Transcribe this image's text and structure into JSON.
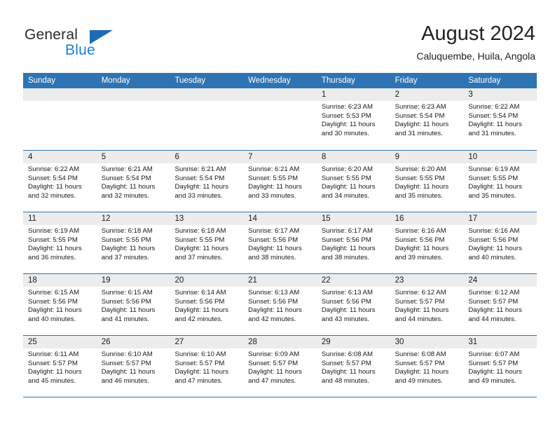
{
  "brand": {
    "name_dark": "General",
    "name_blue": "Blue",
    "accent_blue": "#1f7fd4",
    "triangle_blue": "#1c6cb5"
  },
  "header": {
    "title": "August 2024",
    "subtitle": "Caluquembe, Huila, Angola"
  },
  "calendar": {
    "header_bg": "#2e74b5",
    "daynum_band_bg": "#ececec",
    "weekdays": [
      "Sunday",
      "Monday",
      "Tuesday",
      "Wednesday",
      "Thursday",
      "Friday",
      "Saturday"
    ],
    "weeks": [
      [
        {
          "day": "",
          "sunrise": "",
          "sunset": "",
          "daylight_line1": "",
          "daylight_line2": ""
        },
        {
          "day": "",
          "sunrise": "",
          "sunset": "",
          "daylight_line1": "",
          "daylight_line2": ""
        },
        {
          "day": "",
          "sunrise": "",
          "sunset": "",
          "daylight_line1": "",
          "daylight_line2": ""
        },
        {
          "day": "",
          "sunrise": "",
          "sunset": "",
          "daylight_line1": "",
          "daylight_line2": ""
        },
        {
          "day": "1",
          "sunrise": "Sunrise: 6:23 AM",
          "sunset": "Sunset: 5:53 PM",
          "daylight_line1": "Daylight: 11 hours",
          "daylight_line2": "and 30 minutes."
        },
        {
          "day": "2",
          "sunrise": "Sunrise: 6:23 AM",
          "sunset": "Sunset: 5:54 PM",
          "daylight_line1": "Daylight: 11 hours",
          "daylight_line2": "and 31 minutes."
        },
        {
          "day": "3",
          "sunrise": "Sunrise: 6:22 AM",
          "sunset": "Sunset: 5:54 PM",
          "daylight_line1": "Daylight: 11 hours",
          "daylight_line2": "and 31 minutes."
        }
      ],
      [
        {
          "day": "4",
          "sunrise": "Sunrise: 6:22 AM",
          "sunset": "Sunset: 5:54 PM",
          "daylight_line1": "Daylight: 11 hours",
          "daylight_line2": "and 32 minutes."
        },
        {
          "day": "5",
          "sunrise": "Sunrise: 6:21 AM",
          "sunset": "Sunset: 5:54 PM",
          "daylight_line1": "Daylight: 11 hours",
          "daylight_line2": "and 32 minutes."
        },
        {
          "day": "6",
          "sunrise": "Sunrise: 6:21 AM",
          "sunset": "Sunset: 5:54 PM",
          "daylight_line1": "Daylight: 11 hours",
          "daylight_line2": "and 33 minutes."
        },
        {
          "day": "7",
          "sunrise": "Sunrise: 6:21 AM",
          "sunset": "Sunset: 5:55 PM",
          "daylight_line1": "Daylight: 11 hours",
          "daylight_line2": "and 33 minutes."
        },
        {
          "day": "8",
          "sunrise": "Sunrise: 6:20 AM",
          "sunset": "Sunset: 5:55 PM",
          "daylight_line1": "Daylight: 11 hours",
          "daylight_line2": "and 34 minutes."
        },
        {
          "day": "9",
          "sunrise": "Sunrise: 6:20 AM",
          "sunset": "Sunset: 5:55 PM",
          "daylight_line1": "Daylight: 11 hours",
          "daylight_line2": "and 35 minutes."
        },
        {
          "day": "10",
          "sunrise": "Sunrise: 6:19 AM",
          "sunset": "Sunset: 5:55 PM",
          "daylight_line1": "Daylight: 11 hours",
          "daylight_line2": "and 35 minutes."
        }
      ],
      [
        {
          "day": "11",
          "sunrise": "Sunrise: 6:19 AM",
          "sunset": "Sunset: 5:55 PM",
          "daylight_line1": "Daylight: 11 hours",
          "daylight_line2": "and 36 minutes."
        },
        {
          "day": "12",
          "sunrise": "Sunrise: 6:18 AM",
          "sunset": "Sunset: 5:55 PM",
          "daylight_line1": "Daylight: 11 hours",
          "daylight_line2": "and 37 minutes."
        },
        {
          "day": "13",
          "sunrise": "Sunrise: 6:18 AM",
          "sunset": "Sunset: 5:55 PM",
          "daylight_line1": "Daylight: 11 hours",
          "daylight_line2": "and 37 minutes."
        },
        {
          "day": "14",
          "sunrise": "Sunrise: 6:17 AM",
          "sunset": "Sunset: 5:56 PM",
          "daylight_line1": "Daylight: 11 hours",
          "daylight_line2": "and 38 minutes."
        },
        {
          "day": "15",
          "sunrise": "Sunrise: 6:17 AM",
          "sunset": "Sunset: 5:56 PM",
          "daylight_line1": "Daylight: 11 hours",
          "daylight_line2": "and 38 minutes."
        },
        {
          "day": "16",
          "sunrise": "Sunrise: 6:16 AM",
          "sunset": "Sunset: 5:56 PM",
          "daylight_line1": "Daylight: 11 hours",
          "daylight_line2": "and 39 minutes."
        },
        {
          "day": "17",
          "sunrise": "Sunrise: 6:16 AM",
          "sunset": "Sunset: 5:56 PM",
          "daylight_line1": "Daylight: 11 hours",
          "daylight_line2": "and 40 minutes."
        }
      ],
      [
        {
          "day": "18",
          "sunrise": "Sunrise: 6:15 AM",
          "sunset": "Sunset: 5:56 PM",
          "daylight_line1": "Daylight: 11 hours",
          "daylight_line2": "and 40 minutes."
        },
        {
          "day": "19",
          "sunrise": "Sunrise: 6:15 AM",
          "sunset": "Sunset: 5:56 PM",
          "daylight_line1": "Daylight: 11 hours",
          "daylight_line2": "and 41 minutes."
        },
        {
          "day": "20",
          "sunrise": "Sunrise: 6:14 AM",
          "sunset": "Sunset: 5:56 PM",
          "daylight_line1": "Daylight: 11 hours",
          "daylight_line2": "and 42 minutes."
        },
        {
          "day": "21",
          "sunrise": "Sunrise: 6:13 AM",
          "sunset": "Sunset: 5:56 PM",
          "daylight_line1": "Daylight: 11 hours",
          "daylight_line2": "and 42 minutes."
        },
        {
          "day": "22",
          "sunrise": "Sunrise: 6:13 AM",
          "sunset": "Sunset: 5:56 PM",
          "daylight_line1": "Daylight: 11 hours",
          "daylight_line2": "and 43 minutes."
        },
        {
          "day": "23",
          "sunrise": "Sunrise: 6:12 AM",
          "sunset": "Sunset: 5:57 PM",
          "daylight_line1": "Daylight: 11 hours",
          "daylight_line2": "and 44 minutes."
        },
        {
          "day": "24",
          "sunrise": "Sunrise: 6:12 AM",
          "sunset": "Sunset: 5:57 PM",
          "daylight_line1": "Daylight: 11 hours",
          "daylight_line2": "and 44 minutes."
        }
      ],
      [
        {
          "day": "25",
          "sunrise": "Sunrise: 6:11 AM",
          "sunset": "Sunset: 5:57 PM",
          "daylight_line1": "Daylight: 11 hours",
          "daylight_line2": "and 45 minutes."
        },
        {
          "day": "26",
          "sunrise": "Sunrise: 6:10 AM",
          "sunset": "Sunset: 5:57 PM",
          "daylight_line1": "Daylight: 11 hours",
          "daylight_line2": "and 46 minutes."
        },
        {
          "day": "27",
          "sunrise": "Sunrise: 6:10 AM",
          "sunset": "Sunset: 5:57 PM",
          "daylight_line1": "Daylight: 11 hours",
          "daylight_line2": "and 47 minutes."
        },
        {
          "day": "28",
          "sunrise": "Sunrise: 6:09 AM",
          "sunset": "Sunset: 5:57 PM",
          "daylight_line1": "Daylight: 11 hours",
          "daylight_line2": "and 47 minutes."
        },
        {
          "day": "29",
          "sunrise": "Sunrise: 6:08 AM",
          "sunset": "Sunset: 5:57 PM",
          "daylight_line1": "Daylight: 11 hours",
          "daylight_line2": "and 48 minutes."
        },
        {
          "day": "30",
          "sunrise": "Sunrise: 6:08 AM",
          "sunset": "Sunset: 5:57 PM",
          "daylight_line1": "Daylight: 11 hours",
          "daylight_line2": "and 49 minutes."
        },
        {
          "day": "31",
          "sunrise": "Sunrise: 6:07 AM",
          "sunset": "Sunset: 5:57 PM",
          "daylight_line1": "Daylight: 11 hours",
          "daylight_line2": "and 49 minutes."
        }
      ]
    ]
  }
}
